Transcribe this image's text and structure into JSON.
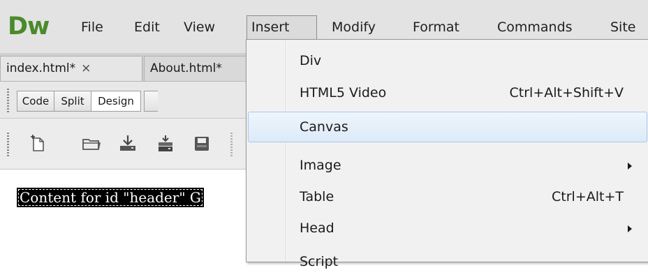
{
  "app": {
    "logo": "Dw",
    "menu": [
      "File",
      "Edit",
      "View",
      "Insert",
      "Modify",
      "Format",
      "Commands",
      "Site"
    ],
    "active_menu": "Insert"
  },
  "tabs": [
    {
      "label": "index.html*",
      "close": "×"
    },
    {
      "label": "About.html*"
    }
  ],
  "view_toolbar": {
    "buttons": [
      "Code",
      "Split",
      "Design"
    ],
    "pressed": "Design"
  },
  "icon_toolbar": {
    "icons": [
      "new-document-icon",
      "open-folder-icon",
      "download-icon",
      "save-icon",
      "print-icon"
    ]
  },
  "design_view": {
    "content_text": "Content for id \"header\" G"
  },
  "insert_menu": {
    "items": [
      {
        "label": "Div",
        "shortcut": "",
        "submenu": false
      },
      {
        "label": "HTML5 Video",
        "shortcut": "Ctrl+Alt+Shift+V",
        "submenu": false
      },
      {
        "label": "Canvas",
        "shortcut": "",
        "submenu": false,
        "highlighted": true
      },
      {
        "label": "Image",
        "shortcut": "",
        "submenu": true
      },
      {
        "label": "Table",
        "shortcut": "Ctrl+Alt+T",
        "submenu": false
      },
      {
        "label": "Head",
        "shortcut": "",
        "submenu": true
      },
      {
        "label": "Script",
        "shortcut": "",
        "submenu": false
      }
    ]
  },
  "colors": {
    "logo": "#4a8a2a",
    "hover_border": "#a9c7ea",
    "hover_fill": "#dceaf8"
  }
}
